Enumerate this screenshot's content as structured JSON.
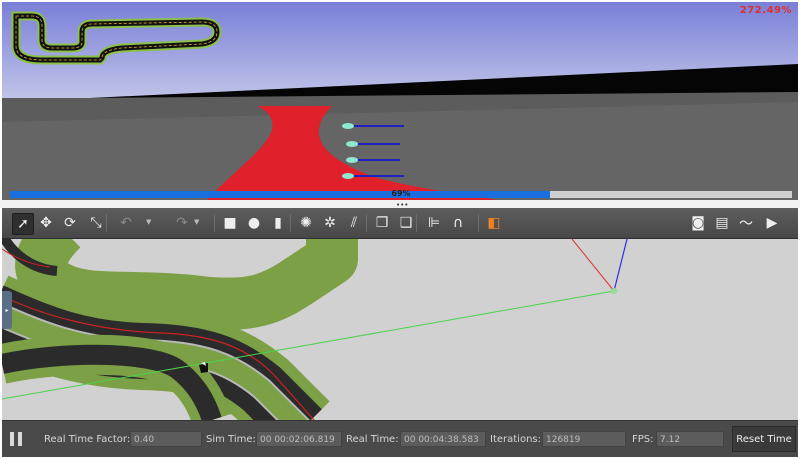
{
  "camera_view": {
    "lap_time": "272.49%",
    "progress_label": "69%",
    "progress_fraction": 0.69
  },
  "toolbar": {
    "tools": [
      {
        "name": "select-mode-icon",
        "glyph": "➚",
        "selected": true
      },
      {
        "name": "translate-mode-icon",
        "glyph": "✥"
      },
      {
        "name": "rotate-mode-icon",
        "glyph": "⟳"
      },
      {
        "name": "scale-mode-icon",
        "glyph": "⤡"
      },
      {
        "name": "undo-icon",
        "glyph": "↶"
      },
      {
        "name": "redo-icon",
        "glyph": "↷"
      },
      {
        "name": "box-shape-icon",
        "glyph": "■"
      },
      {
        "name": "sphere-shape-icon",
        "glyph": "●"
      },
      {
        "name": "cylinder-shape-icon",
        "glyph": "▮"
      },
      {
        "name": "point-light-icon",
        "glyph": "✺"
      },
      {
        "name": "spot-light-icon",
        "glyph": "✲"
      },
      {
        "name": "directional-light-icon",
        "glyph": "⫽"
      },
      {
        "name": "copy-icon",
        "glyph": "❐"
      },
      {
        "name": "paste-icon",
        "glyph": "❑"
      },
      {
        "name": "align-icon",
        "glyph": "⊫"
      },
      {
        "name": "snap-icon",
        "glyph": "∩"
      },
      {
        "name": "view-angle-icon",
        "glyph": "◧"
      },
      {
        "name": "screenshot-icon",
        "glyph": "◙"
      },
      {
        "name": "log-icon",
        "glyph": "▤"
      },
      {
        "name": "plot-icon",
        "glyph": "〜"
      },
      {
        "name": "video-record-icon",
        "glyph": "▶"
      }
    ]
  },
  "status_bar": {
    "real_time_factor_label": "Real Time Factor:",
    "real_time_factor": "0.40",
    "sim_time_label": "Sim Time:",
    "sim_time": "00 00:02:06.819",
    "real_time_label": "Real Time:",
    "real_time": "00 00:04:38.583",
    "iterations_label": "Iterations:",
    "iterations": "126819",
    "fps_label": "FPS:",
    "fps": "7.12",
    "reset_label": "Reset Time"
  },
  "colors": {
    "track_red": "#e0202a",
    "progress_blue": "#1a6fe0",
    "grass_green": "#7ba045",
    "asphalt": "#2a2a2a"
  }
}
